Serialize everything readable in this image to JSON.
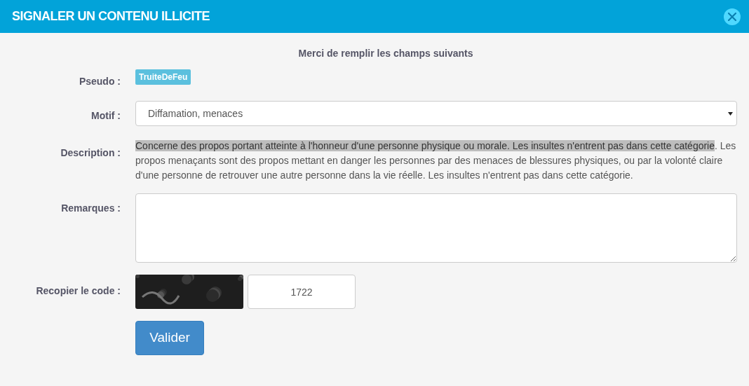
{
  "window": {
    "title": "SIGNALER UN CONTENU ILLICITE"
  },
  "intro": "Merci de remplir les champs suivants",
  "pseudo": {
    "label": "Pseudo :",
    "value": "TruiteDeFeu"
  },
  "motif": {
    "label": "Motif :",
    "value": "Diffamation, menaces"
  },
  "description": {
    "label": "Description :",
    "parts": [
      {
        "text": "Concerne des propos portant atteinte à l'honneur d'une personne physique ou morale. Les insultes n'entrent pas dans cette catégorie",
        "selected": true
      },
      {
        "text": ". Les propos menaçants sont des propos mettant en danger les personnes par des menaces de blessures physiques, ou par la volonté claire d'une personne de retrouver une autre personne dans la vie réelle. Les insultes n'entrent pas dans cette catégorie.",
        "selected": false
      }
    ]
  },
  "remarques": {
    "label": "Remarques :"
  },
  "code": {
    "label": "Recopier le code :",
    "value": "1722"
  },
  "submit": "Valider"
}
